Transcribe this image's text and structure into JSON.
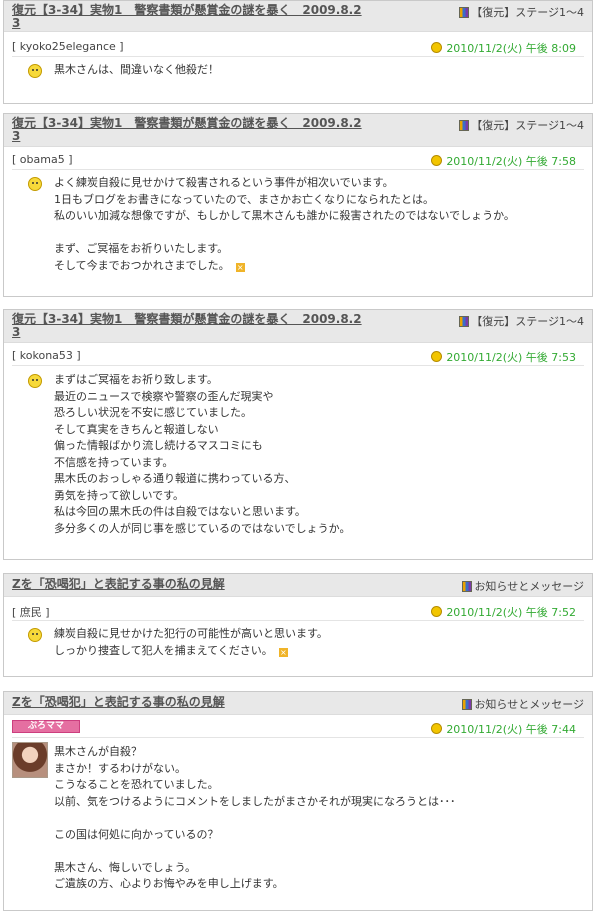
{
  "posts": [
    {
      "title": "復元【3-34】実物1　警察書類が懸賞金の謎を暴く　2009.8.23",
      "category": "【復元】ステージ1～4",
      "author": "[ kyoko25elegance ]",
      "date": "2010/11/2(火) 午後 8:09",
      "icon": "smiley-icon",
      "lines": [
        "黒木さんは、間違いなく他殺だ！"
      ]
    },
    {
      "title": "復元【3-34】実物1　警察書類が懸賞金の謎を暴く　2009.8.23",
      "category": "【復元】ステージ1～4",
      "author": "[ obama5 ]",
      "date": "2010/11/2(火) 午後 7:58",
      "icon": "smiley-icon",
      "lines": [
        "よく練炭自殺に見せかけて殺害されるという事件が相次いでいます。",
        "1日もブログをお書きになっていたので、まさかお亡くなりになられたとは。",
        "私のいい加減な想像ですが、もしかして黒木さんも誰かに殺害されたのではないでしょうか。",
        "",
        "まず、ご冥福をお祈りいたします。",
        "そして今までおつかれさまでした。"
      ]
    },
    {
      "title": "復元【3-34】実物1　警察書類が懸賞金の謎を暴く　2009.8.23",
      "category": "【復元】ステージ1～4",
      "author": "[ kokona53 ]",
      "date": "2010/11/2(火) 午後 7:53",
      "icon": "smiley-icon",
      "lines": [
        "まずはご冥福をお祈り致します。",
        "最近のニュースで検察や警察の歪んだ現実や",
        "恐ろしい状況を不安に感じていました。",
        "そして真実をきちんと報道しない",
        "偏った情報ばかり流し続けるマスコミにも",
        "不信感を持っています。",
        "黒木氏のおっしゃる通り報道に携わっている方、",
        "勇気を持って欲しいです。",
        "私は今回の黒木氏の件は自殺ではないと思います。",
        "多分多くの人が同じ事を感じているのではないでしょうか。"
      ]
    },
    {
      "title": "Zを「恐喝犯」と表記する事の私の見解",
      "category": "お知らせとメッセージ",
      "author": "[ 庶民 ]",
      "date": "2010/11/2(火) 午後 7:52",
      "icon": "smiley-icon",
      "lines": [
        "練炭自殺に見せかけた犯行の可能性が高いと思います。",
        "しっかり捜査して犯人を捕まえてください。"
      ]
    },
    {
      "title": "Zを「恐喝犯」と表記する事の私の見解",
      "category": "お知らせとメッセージ",
      "author_badge": "ぷろママ",
      "date": "2010/11/2(火) 午後 7:44",
      "icon": "avatar",
      "lines": [
        "黒木さんが自殺？",
        "まさか！するわけがない。",
        "こうなることを恐れていました。",
        "以前、気をつけるようにコメントをしましたがまさかそれが現実になろうとは･･･",
        "",
        "この国は何処に向かっているの？",
        "",
        "黒木さん、悔しいでしょう。",
        "ご遺族の方、心よりお悔やみを申し上げます。"
      ]
    }
  ]
}
